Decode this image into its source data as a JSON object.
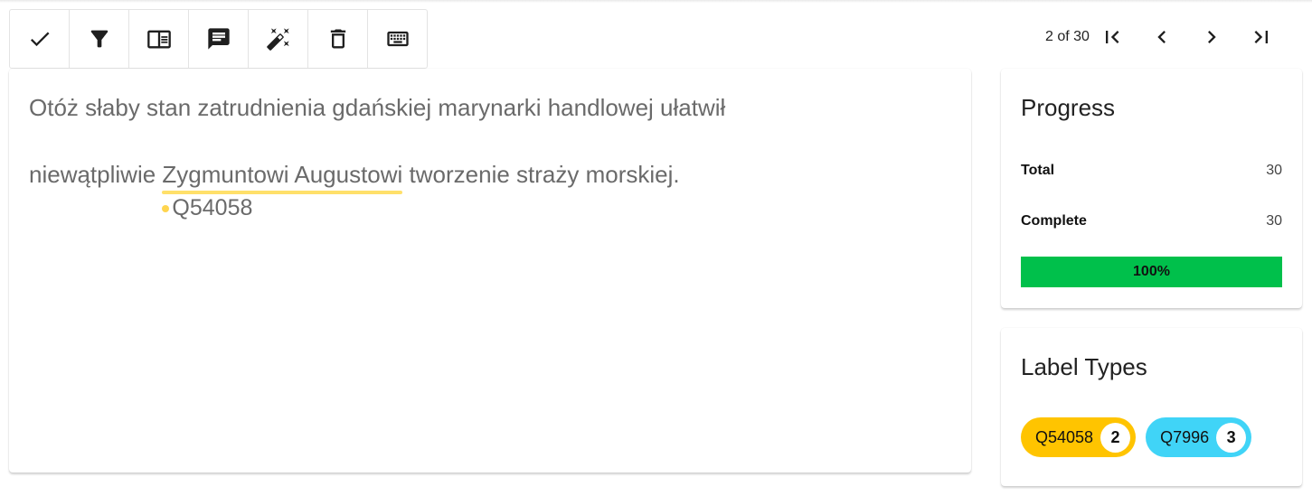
{
  "toolbar": {
    "buttons": [
      {
        "icon": "check-icon"
      },
      {
        "icon": "filter-icon"
      },
      {
        "icon": "reader-view-icon"
      },
      {
        "icon": "comment-icon"
      },
      {
        "icon": "magic-wand-icon"
      },
      {
        "icon": "delete-icon"
      },
      {
        "icon": "keyboard-icon"
      }
    ]
  },
  "pager": {
    "text": "2 of 30",
    "buttons": [
      "first-page-icon",
      "prev-page-icon",
      "next-page-icon",
      "last-page-icon"
    ]
  },
  "document": {
    "line1": "Otóż słaby stan zatrudnienia gdańskiej marynarki handlowej ułatwił",
    "line2_before": "niewątpliwie ",
    "entity_text": "Zygmuntowi Augustowi",
    "line2_after": " tworzenie straży morskiej.",
    "entity_label": "Q54058",
    "entity_color": "#ffe06a"
  },
  "progress": {
    "title": "Progress",
    "total_label": "Total",
    "total_value": "30",
    "complete_label": "Complete",
    "complete_value": "30",
    "percent_text": "100%",
    "fraction": 1.0,
    "bar_color": "#00c04b"
  },
  "label_types": {
    "title": "Label Types",
    "items": [
      {
        "name": "Q54058",
        "count": "2",
        "color": "#ffc400"
      },
      {
        "name": "Q7996",
        "count": "3",
        "color": "#40d4f7"
      }
    ]
  }
}
